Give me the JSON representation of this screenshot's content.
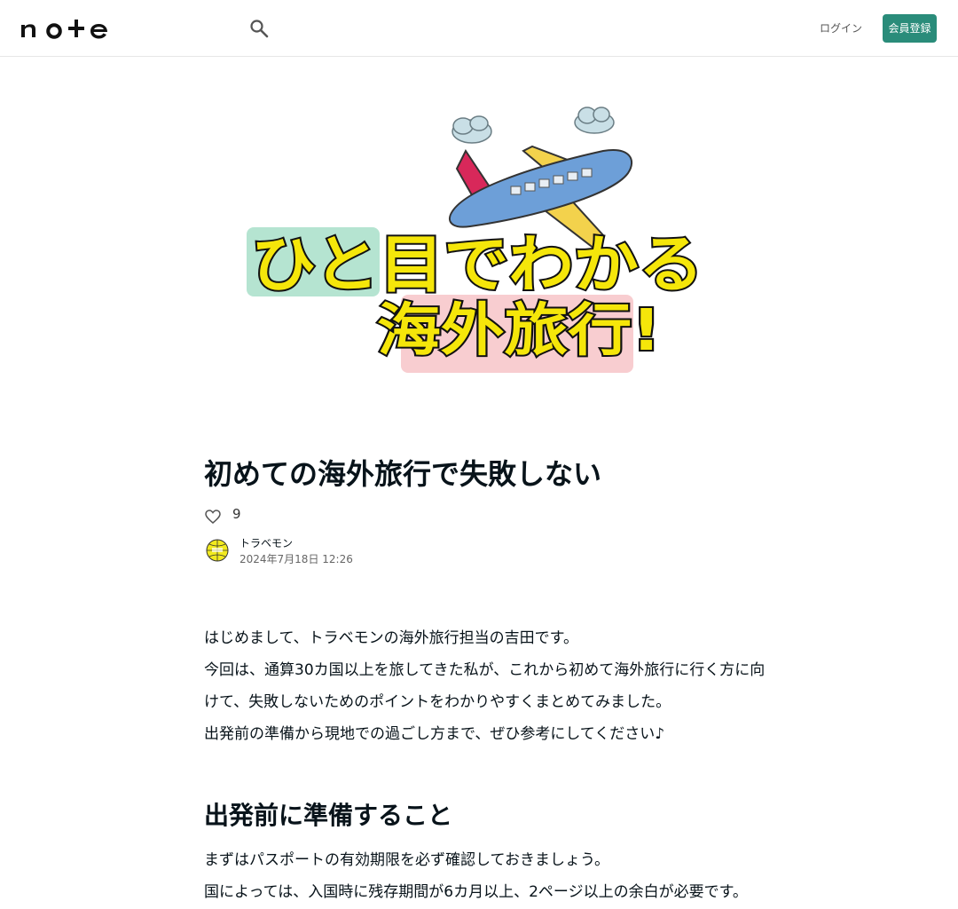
{
  "header": {
    "logo_text": "note",
    "search_icon": "search-icon",
    "login_label": "ログイン",
    "signup_label": "会員登録",
    "brand_color": "#2a8c7a"
  },
  "hero": {
    "line1": "ひと目でわかる",
    "line2": "海外旅行!"
  },
  "article": {
    "title": "初めての海外旅行で失敗しない",
    "like_count": "9",
    "author_name": "トラベモン",
    "post_date": "2024年7月18日 12:26",
    "paragraphs": [
      "はじめまして、トラベモンの海外旅行担当の吉田です。",
      "今回は、通算30カ国以上を旅してきた私が、これから初めて海外旅行に行く方に向けて、失敗しないためのポイントをわかりやすくまとめてみました。",
      "出発前の準備から現地での過ごし方まで、ぜひ参考にしてください♪"
    ],
    "section_heading": "出発前に準備すること",
    "section_paragraphs": [
      "まずはパスポートの有効期限を必ず確認しておきましょう。",
      "国によっては、入国時に残存期間が6カ月以上、2ページ以上の余白が必要です。"
    ]
  }
}
